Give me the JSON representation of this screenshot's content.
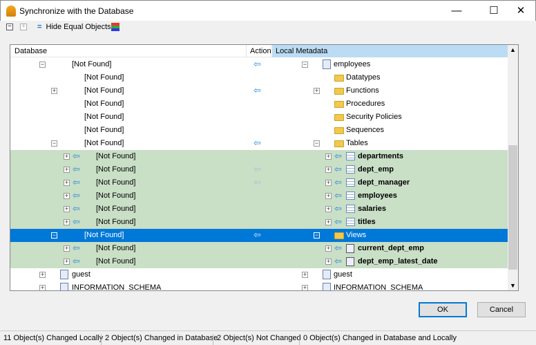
{
  "window": {
    "title": "Synchronize with the Database",
    "minimize": "—",
    "maximize": "☐",
    "close": "✕"
  },
  "toolbar": {
    "collapse": "−",
    "expand": "+",
    "hide_equal": "Hide Equal Objects",
    "colors_icon": "color-palette-icon"
  },
  "columns": {
    "database": "Database",
    "action": "Action",
    "local": "Local Metadata"
  },
  "colors": {
    "changed_row": "#c9dfc6",
    "selected_row": "#0078d7",
    "arrow": "#2a8ad8"
  },
  "rows": [
    {
      "db": "[Not Found]",
      "local": "employees",
      "bg": "white",
      "action": "arrow",
      "dbexp": "−",
      "lexp": "−",
      "icon": "schema"
    },
    {
      "db": "[Not Found]",
      "local": "Datatypes",
      "bg": "white",
      "action": "",
      "icon": "folder"
    },
    {
      "db": "[Not Found]",
      "local": "Functions",
      "bg": "white",
      "action": "arrow",
      "dbexp": "+",
      "lexp": "+",
      "icon": "folder"
    },
    {
      "db": "[Not Found]",
      "local": "Procedures",
      "bg": "white",
      "action": "",
      "icon": "folder"
    },
    {
      "db": "[Not Found]",
      "local": "Security Policies",
      "bg": "white",
      "action": "",
      "icon": "folder"
    },
    {
      "db": "[Not Found]",
      "local": "Sequences",
      "bg": "white",
      "action": "",
      "icon": "folder"
    },
    {
      "db": "[Not Found]",
      "local": "Tables",
      "bg": "white",
      "action": "arrow",
      "dbexp": "−",
      "lexp": "−",
      "icon": "folder"
    },
    {
      "db": "[Not Found]",
      "local": "departments",
      "bg": "green",
      "action": "",
      "icon": "table"
    },
    {
      "db": "[Not Found]",
      "local": "dept_emp",
      "bg": "green",
      "action": "faded",
      "icon": "table"
    },
    {
      "db": "[Not Found]",
      "local": "dept_manager",
      "bg": "green",
      "action": "faded",
      "icon": "table"
    },
    {
      "db": "[Not Found]",
      "local": "employees",
      "bg": "green",
      "action": "",
      "icon": "table"
    },
    {
      "db": "[Not Found]",
      "local": "salaries",
      "bg": "green",
      "action": "",
      "icon": "table"
    },
    {
      "db": "[Not Found]",
      "local": "titles",
      "bg": "green",
      "action": "",
      "icon": "table"
    },
    {
      "db": "[Not Found]",
      "local": "Views",
      "bg": "selected",
      "action": "faded",
      "dbexp": "−",
      "lexp": "−",
      "icon": "folder"
    },
    {
      "db": "[Not Found]",
      "local": "current_dept_emp",
      "bg": "green",
      "action": "",
      "icon": "view"
    },
    {
      "db": "[Not Found]",
      "local": "dept_emp_latest_date",
      "bg": "green",
      "action": "",
      "icon": "view"
    },
    {
      "db": "guest",
      "local": "guest",
      "bg": "white",
      "action": "",
      "dbexp": "+",
      "lexp": "+",
      "icon": "schema"
    },
    {
      "db": "INFORMATION_SCHEMA",
      "local": "INFORMATION_SCHEMA",
      "bg": "white",
      "action": "",
      "dbexp": "+",
      "lexp": "+",
      "icon": "schema"
    }
  ],
  "buttons": {
    "ok": "OK",
    "cancel": "Cancel"
  },
  "status": [
    "11 Object(s) Changed Locally",
    "2 Object(s) Changed in Database",
    "2 Object(s) Not Changed",
    "0 Object(s) Changed in Database and Locally"
  ]
}
